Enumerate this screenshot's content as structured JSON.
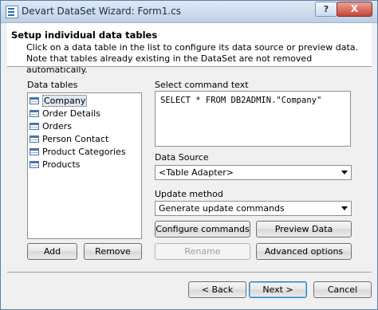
{
  "window": {
    "title": "Devart DataSet Wizard: Form1.cs",
    "help_label": "?",
    "close_label": "X"
  },
  "header": {
    "title": "Setup individual data tables",
    "description": "Click on a data table in the list to configure its data source or preview data. Note that tables already existing in the DataSet are not removed automatically."
  },
  "tables": {
    "label": "Data tables",
    "items": [
      "Company",
      "Order Details",
      "Orders",
      "Person Contact",
      "Product Categories",
      "Products"
    ],
    "selected": "Company",
    "add_label": "Add",
    "remove_label": "Remove"
  },
  "command": {
    "label": "Select command text",
    "text": "SELECT * FROM DB2ADMIN.\"Company\""
  },
  "data_source": {
    "label": "Data Source",
    "value": "<Table Adapter>"
  },
  "update_method": {
    "label": "Update method",
    "value": "Generate update commands"
  },
  "actions": {
    "configure_label": "Configure commands",
    "preview_label": "Preview Data",
    "rename_label": "Rename",
    "advanced_label": "Advanced options"
  },
  "footer": {
    "back_label": "< Back",
    "next_label": "Next >",
    "cancel_label": "Cancel"
  }
}
